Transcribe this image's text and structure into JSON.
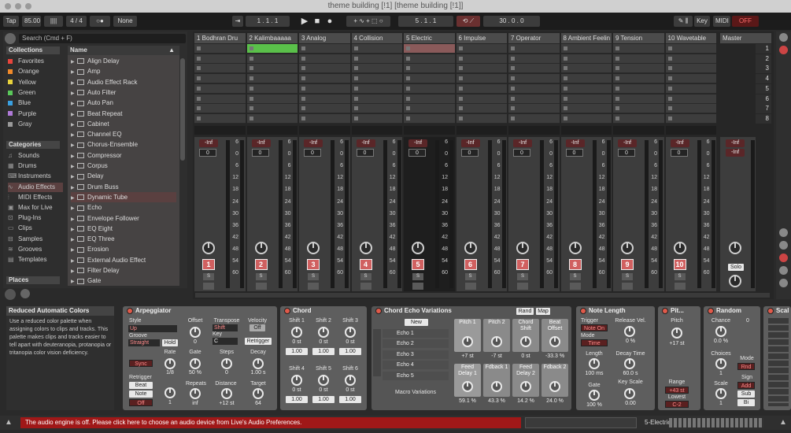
{
  "window": {
    "title": "theme building [!1]  [theme building [!1]]"
  },
  "toolbar": {
    "tap": "Tap",
    "bpm": "85.00",
    "sig": "4 / 4",
    "rec_mode": "○●",
    "quantize": "None",
    "arr_pos": "1 . 1 . 1",
    "loop_start": "5 . 1 . 1",
    "loop_len": "30 . 0 . 0",
    "key": "Key",
    "midi": "MIDI",
    "off": "OFF",
    "play_icon": "play-icon",
    "stop_icon": "stop-icon",
    "record_icon": "record-icon"
  },
  "browser": {
    "search_placeholder": "Search (Cmd + F)",
    "collections_title": "Collections",
    "collections": [
      {
        "label": "Favorites",
        "color": "#e8453c"
      },
      {
        "label": "Orange",
        "color": "#f08a2a"
      },
      {
        "label": "Yellow",
        "color": "#e8d23c"
      },
      {
        "label": "Green",
        "color": "#5ac85a"
      },
      {
        "label": "Blue",
        "color": "#3aa0e0"
      },
      {
        "label": "Purple",
        "color": "#b07ad8"
      },
      {
        "label": "Gray",
        "color": "#9a9a9a"
      }
    ],
    "categories_title": "Categories",
    "categories": [
      "Sounds",
      "Drums",
      "Instruments",
      "Audio Effects",
      "MIDI Effects",
      "Max for Live",
      "Plug-Ins",
      "Clips",
      "Samples",
      "Grooves",
      "Templates"
    ],
    "places_title": "Places",
    "name_header": "Name",
    "items": [
      "Align Delay",
      "Amp",
      "Audio Effect Rack",
      "Auto Filter",
      "Auto Pan",
      "Beat Repeat",
      "Cabinet",
      "Channel EQ",
      "Chorus-Ensemble",
      "Compressor",
      "Corpus",
      "Delay",
      "Drum Buss",
      "Dynamic Tube",
      "Echo",
      "Envelope Follower",
      "EQ Eight",
      "EQ Three",
      "Erosion",
      "External Audio Effect",
      "Filter Delay",
      "Gate"
    ]
  },
  "tracks": [
    {
      "name": "1 Bodhran Dru",
      "num": "1"
    },
    {
      "name": "2 Kalimbaaaaa",
      "num": "2"
    },
    {
      "name": "3 Analog",
      "num": "3"
    },
    {
      "name": "4 Collision",
      "num": "4"
    },
    {
      "name": "5 Electric",
      "num": "5"
    },
    {
      "name": "6 Impulse",
      "num": "6"
    },
    {
      "name": "7 Operator",
      "num": "7"
    },
    {
      "name": "8 Ambient Feelin",
      "num": "8"
    },
    {
      "name": "9 Tension",
      "num": "9"
    },
    {
      "name": "10 Wavetable",
      "num": "10"
    }
  ],
  "master": {
    "name": "Master",
    "solo": "Solo"
  },
  "scenes": [
    "1",
    "2",
    "3",
    "4",
    "5",
    "6",
    "7",
    "8"
  ],
  "mixer": {
    "vol": "-Inf",
    "pan": "0",
    "db_labels": [
      "6",
      "0",
      "6",
      "12",
      "18",
      "24",
      "30",
      "36",
      "42",
      "48",
      "54",
      "60"
    ],
    "s": "S"
  },
  "info": {
    "title": "Reduced Automatic Colors",
    "text": "Use a reduced color palette when assigning colors to clips and tracks. This palette makes clips and tracks easier to tell apart with deuteranopia, protanopia or tritanopia color vision deficiency."
  },
  "devices": {
    "arp": {
      "title": "Arpeggiator",
      "style_lbl": "Style",
      "style": "Up",
      "groove_lbl": "Groove",
      "groove": "Straight",
      "hold": "Hold",
      "offset_lbl": "Offset",
      "offset": "0",
      "transpose_lbl": "Transpose",
      "transpose": "Shift",
      "key_lbl": "Key",
      "key": "C",
      "velocity_lbl": "Velocity",
      "velocity": "Off",
      "retrigger_btn": "Retrigger",
      "sync": "Sync",
      "rate_lbl": "Rate",
      "rate": "1/8",
      "gate_lbl": "Gate",
      "gate": "50 %",
      "steps_lbl": "Steps",
      "steps": "0",
      "decay_lbl": "Decay",
      "decay": "1.00 s",
      "retrig_lbl": "Retrigger",
      "beat": "Beat",
      "note": "Note",
      "off": "Off",
      "repeats_lbl": "Repeats",
      "repeats": "inf",
      "rep_num": "1",
      "distance_lbl": "Distance",
      "distance": "+12 st",
      "target_lbl": "Target",
      "target": "64"
    },
    "chord": {
      "title": "Chord",
      "shifts": [
        "Shift 1",
        "Shift 2",
        "Shift 3",
        "Shift 4",
        "Shift 5",
        "Shift 6"
      ],
      "st": "0 st",
      "vel": "1.00"
    },
    "echo": {
      "title": "Chord Echo Variations",
      "rand": "Rand",
      "map": "Map",
      "new": "New",
      "echoes": [
        "Echo 1",
        "Echo 2",
        "Echo 3",
        "Echo 4",
        "Echo 5"
      ],
      "macro": "Macro Variations",
      "macros": [
        {
          "l": "Pitch 1",
          "v": "+7 st"
        },
        {
          "l": "Pitch 2",
          "v": "-7 st"
        },
        {
          "l": "Chord Shift",
          "v": "0 st"
        },
        {
          "l": "Beat Offset",
          "v": "-33.3 %"
        },
        {
          "l": "Feed Delay 1",
          "v": "59.1 %"
        },
        {
          "l": "Fdback 1",
          "v": "43.3 %"
        },
        {
          "l": "Feed Delay 2",
          "v": "14.2 %"
        },
        {
          "l": "Fdback 2",
          "v": "24.0 %"
        }
      ]
    },
    "notelen": {
      "title": "Note Length",
      "trigger_lbl": "Trigger",
      "trigger": "Note On",
      "release_lbl": "Release Vel.",
      "release": "0 %",
      "mode_lbl": "Mode",
      "mode": "Time",
      "length_lbl": "Length",
      "length": "100 ms",
      "decay_lbl": "Decay Time",
      "decay": "60.0 s",
      "gate_lbl": "Gate",
      "gate": "100 %",
      "keyscale_lbl": "Key Scale",
      "keyscale": "0.00"
    },
    "pitch": {
      "title": "Pit...",
      "pitch_lbl": "Pitch",
      "pitch": "+17 st",
      "range_lbl": "Range",
      "range": "+43 st",
      "lowest_lbl": "Lowest",
      "lowest": "C-2"
    },
    "random": {
      "title": "Random",
      "chance_lbl": "Chance",
      "chance": "0.0 %",
      "choices_lbl": "Choices",
      "choices": "1",
      "scale_lbl": "Scale",
      "scale": "1",
      "mode_lbl": "Mode",
      "mode": "Rnd",
      "sign_lbl": "Sign",
      "add": "Add",
      "sub": "Sub",
      "bi": "Bi",
      "zero": "0"
    },
    "scale": {
      "title": "Scal"
    }
  },
  "status": {
    "message": "The audio engine is off. Please click here to choose an audio device from Live's Audio Preferences.",
    "track": "5-Electric"
  }
}
